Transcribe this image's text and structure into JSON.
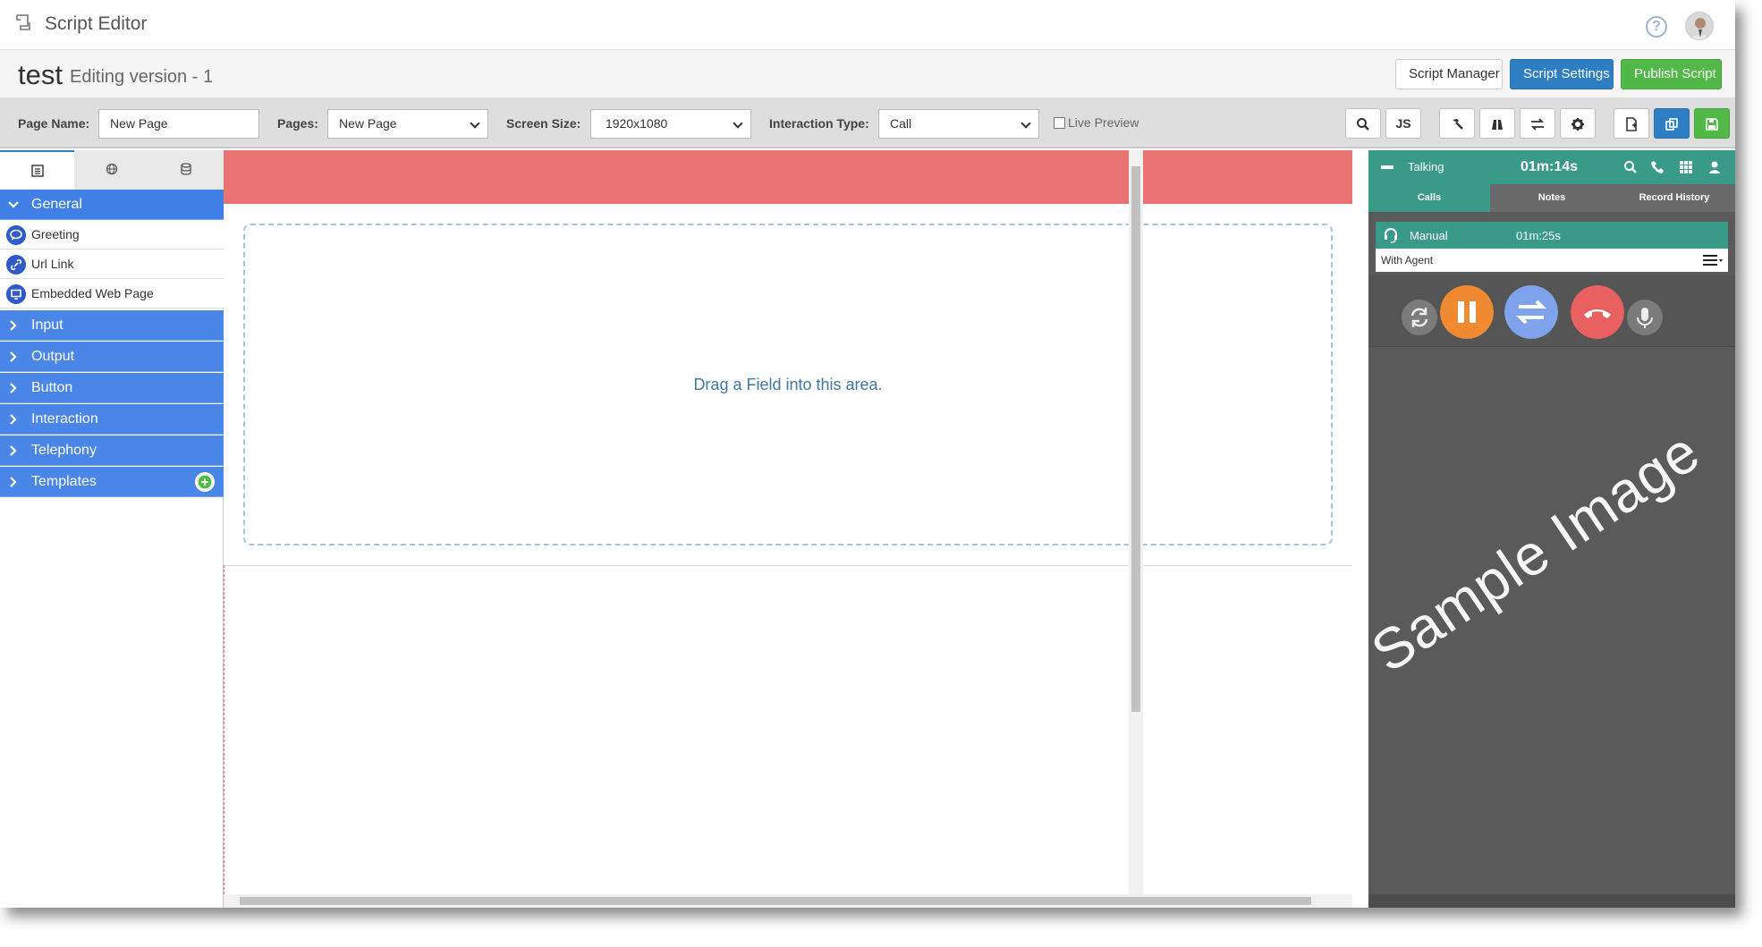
{
  "app": {
    "title": "Script Editor"
  },
  "script": {
    "name": "test",
    "version_label": "Editing version - 1"
  },
  "header_buttons": {
    "manager": "Script Manager",
    "settings": "Script Settings",
    "publish": "Publish Script"
  },
  "toolbar": {
    "page_name_label": "Page Name:",
    "page_name_value": "New Page",
    "pages_label": "Pages:",
    "pages_value": "New Page",
    "screen_size_label": "Screen Size:",
    "screen_size_value": "1920x1080",
    "interaction_type_label": "Interaction Type:",
    "interaction_type_value": "Call",
    "live_preview_label": "Live Preview",
    "js_label": "JS"
  },
  "sidebar": {
    "general": "General",
    "items": [
      "Greeting",
      "Url Link",
      "Embedded Web Page"
    ],
    "categories": [
      "Input",
      "Output",
      "Button",
      "Interaction",
      "Telephony",
      "Templates"
    ]
  },
  "canvas": {
    "drop_text": "Drag a Field into this area."
  },
  "phone": {
    "status": "Talking",
    "timer": "01m:14s",
    "tabs": [
      "Calls",
      "Notes",
      "Record History"
    ],
    "call_mode": "Manual",
    "call_timer": "01m:25s",
    "call_state": "With Agent",
    "watermark": "Sample Image"
  },
  "colors": {
    "accent_blue": "#2e7ec4",
    "publish_green": "#52b848",
    "category_blue": "#4a86e8",
    "teal": "#3a9a88",
    "hold_orange": "#f08a30",
    "transfer_blue": "#7fa2ec",
    "hangup_red": "#e86060"
  }
}
